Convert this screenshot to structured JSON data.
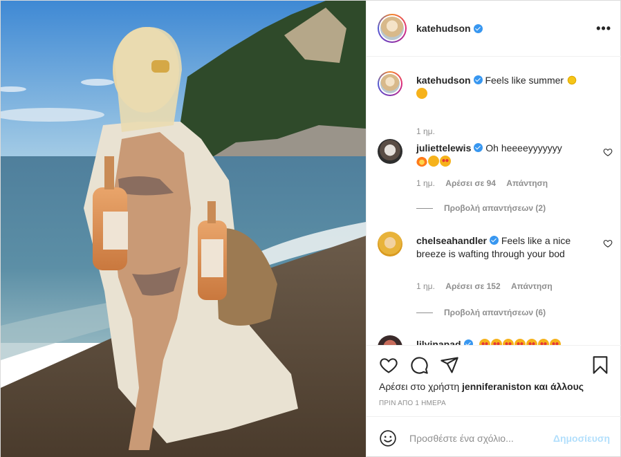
{
  "post": {
    "author": "katehudson",
    "verified": true,
    "more_icon": "more-horizontal-icon",
    "caption": {
      "username": "katehudson",
      "text": "Feels like summer",
      "emojis": [
        "sun-emoji",
        "tongue-face-emoji"
      ],
      "time": "1 ημ."
    },
    "comments": [
      {
        "username": "juliettelewis",
        "verified": true,
        "text": "Oh heeeeyyyyyyy",
        "emojis": [
          "fire-emoji",
          "raising-hands-emoji",
          "heart-eyes-emoji"
        ],
        "time": "1 ημ.",
        "likes": "Αρέσει σε 94",
        "reply": "Απάντηση",
        "view_replies": "Προβολή απαντήσεων (2)"
      },
      {
        "username": "chelseahandler",
        "verified": true,
        "text": "Feels like a nice breeze is wafting through your bod",
        "time": "1 ημ.",
        "likes": "Αρέσει σε 152",
        "reply": "Απάντηση",
        "view_replies": "Προβολή απαντήσεων (6)"
      },
      {
        "username": "lilyinapad",
        "verified": true,
        "emojis": [
          "heart-eyes-emoji",
          "heart-eyes-emoji",
          "heart-eyes-emoji",
          "heart-eyes-emoji",
          "heart-eyes-emoji",
          "heart-eyes-emoji",
          "heart-eyes-emoji"
        ]
      }
    ],
    "actions": {
      "like_icon": "heart-outline-icon",
      "comment_icon": "comment-icon",
      "share_icon": "paper-plane-icon",
      "save_icon": "bookmark-icon"
    },
    "likes_line": {
      "prefix": "Αρέσει στο χρήστη",
      "user": "jenniferaniston",
      "suffix": "και άλλους"
    },
    "date": "ΠΡΙΝ ΑΠΟ 1 ΗΜΕΡΑ",
    "add_comment": {
      "placeholder": "Προσθέστε ένα σχόλιο...",
      "value": "",
      "post_label": "Δημοσίευση",
      "emoji_icon": "smiley-icon"
    }
  },
  "colors": {
    "accent": "#3897f0",
    "post_disabled": "#b2dffc",
    "secondary_text": "#8e8e8e",
    "border": "#efefef"
  }
}
